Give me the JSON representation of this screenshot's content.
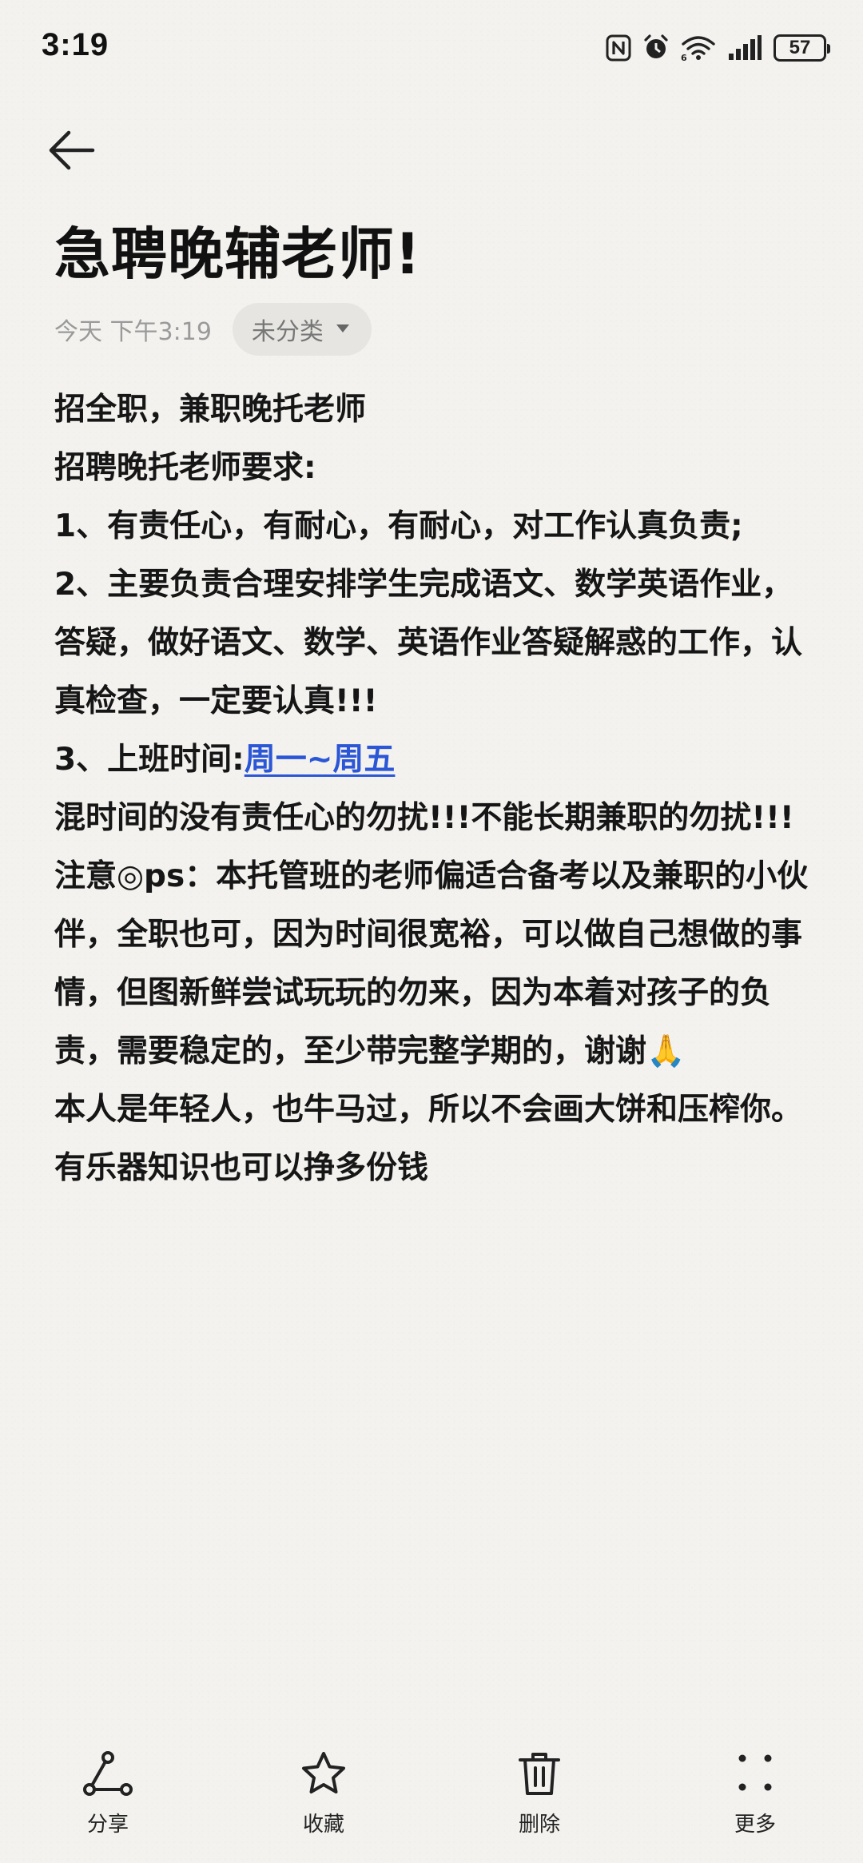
{
  "status_bar": {
    "time": "3:19",
    "battery": "57"
  },
  "header": {
    "back_icon": "back-arrow-icon"
  },
  "note": {
    "title": "急聘晚辅老师!",
    "date": "今天 下午3:19",
    "category": "未分类",
    "lines": {
      "l1": "招全职，兼职晚托老师",
      "l2": "招聘晚托老师要求:",
      "l3": "1、有责任心，有耐心，有耐心，对工作认真负责;",
      "l4": "2、主要负责合理安排学生完成语文、数学英语作业，答疑，做好语文、数学、英语作业答疑解惑的工作，认真检查，一定要认真!!!",
      "l5_prefix": "3、上班时间:",
      "l5_link": "周一~周五",
      "l6": "混时间的没有责任心的勿扰!!!不能长期兼职的勿扰!!!",
      "l7": "注意◎ps：本托管班的老师偏适合备考以及兼职的小伙伴，全职也可，因为时间很宽裕，可以做自己想做的事情，但图新鲜尝试玩玩的勿来，因为本着对孩子的负责，需要稳定的，至少带完整学期的，谢谢🙏",
      "l8": "本人是年轻人，也牛马过，所以不会画大饼和压榨你。",
      "l9": "有乐器知识也可以挣多份钱"
    }
  },
  "toolbar": {
    "share": "分享",
    "favorite": "收藏",
    "delete": "删除",
    "more": "更多"
  }
}
